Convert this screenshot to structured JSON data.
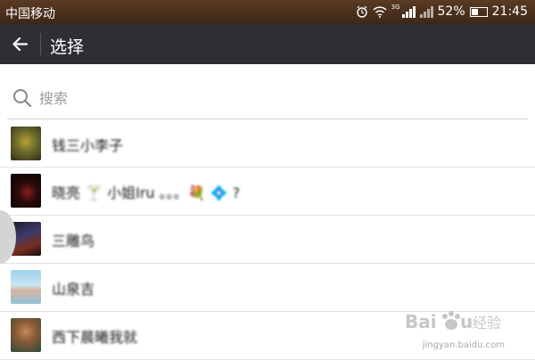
{
  "status_bar": {
    "carrier": "中国移动",
    "network": "3G",
    "battery": "52%",
    "battery_level": 0.52,
    "time": "21:45"
  },
  "title_bar": {
    "title": "选择"
  },
  "search": {
    "placeholder": "搜索"
  },
  "contacts": [
    {
      "name": "钱三小李子"
    },
    {
      "name": "晓亮 🍸 小姐Iru 。。。💐 💠 ?"
    },
    {
      "name": "三雕鸟"
    },
    {
      "name": "山泉吉"
    },
    {
      "name": "西下晨曦我就"
    }
  ],
  "watermark": {
    "brand": "Baidu 经验",
    "url": "jingyan.baidu.com"
  },
  "colors": {
    "title_bar": "#2e2f33",
    "status_bar": "#4a3220"
  },
  "icons": [
    "back-arrow-icon",
    "search-icon",
    "alarm-icon",
    "wifi-icon",
    "signal-icon",
    "battery-icon"
  ]
}
